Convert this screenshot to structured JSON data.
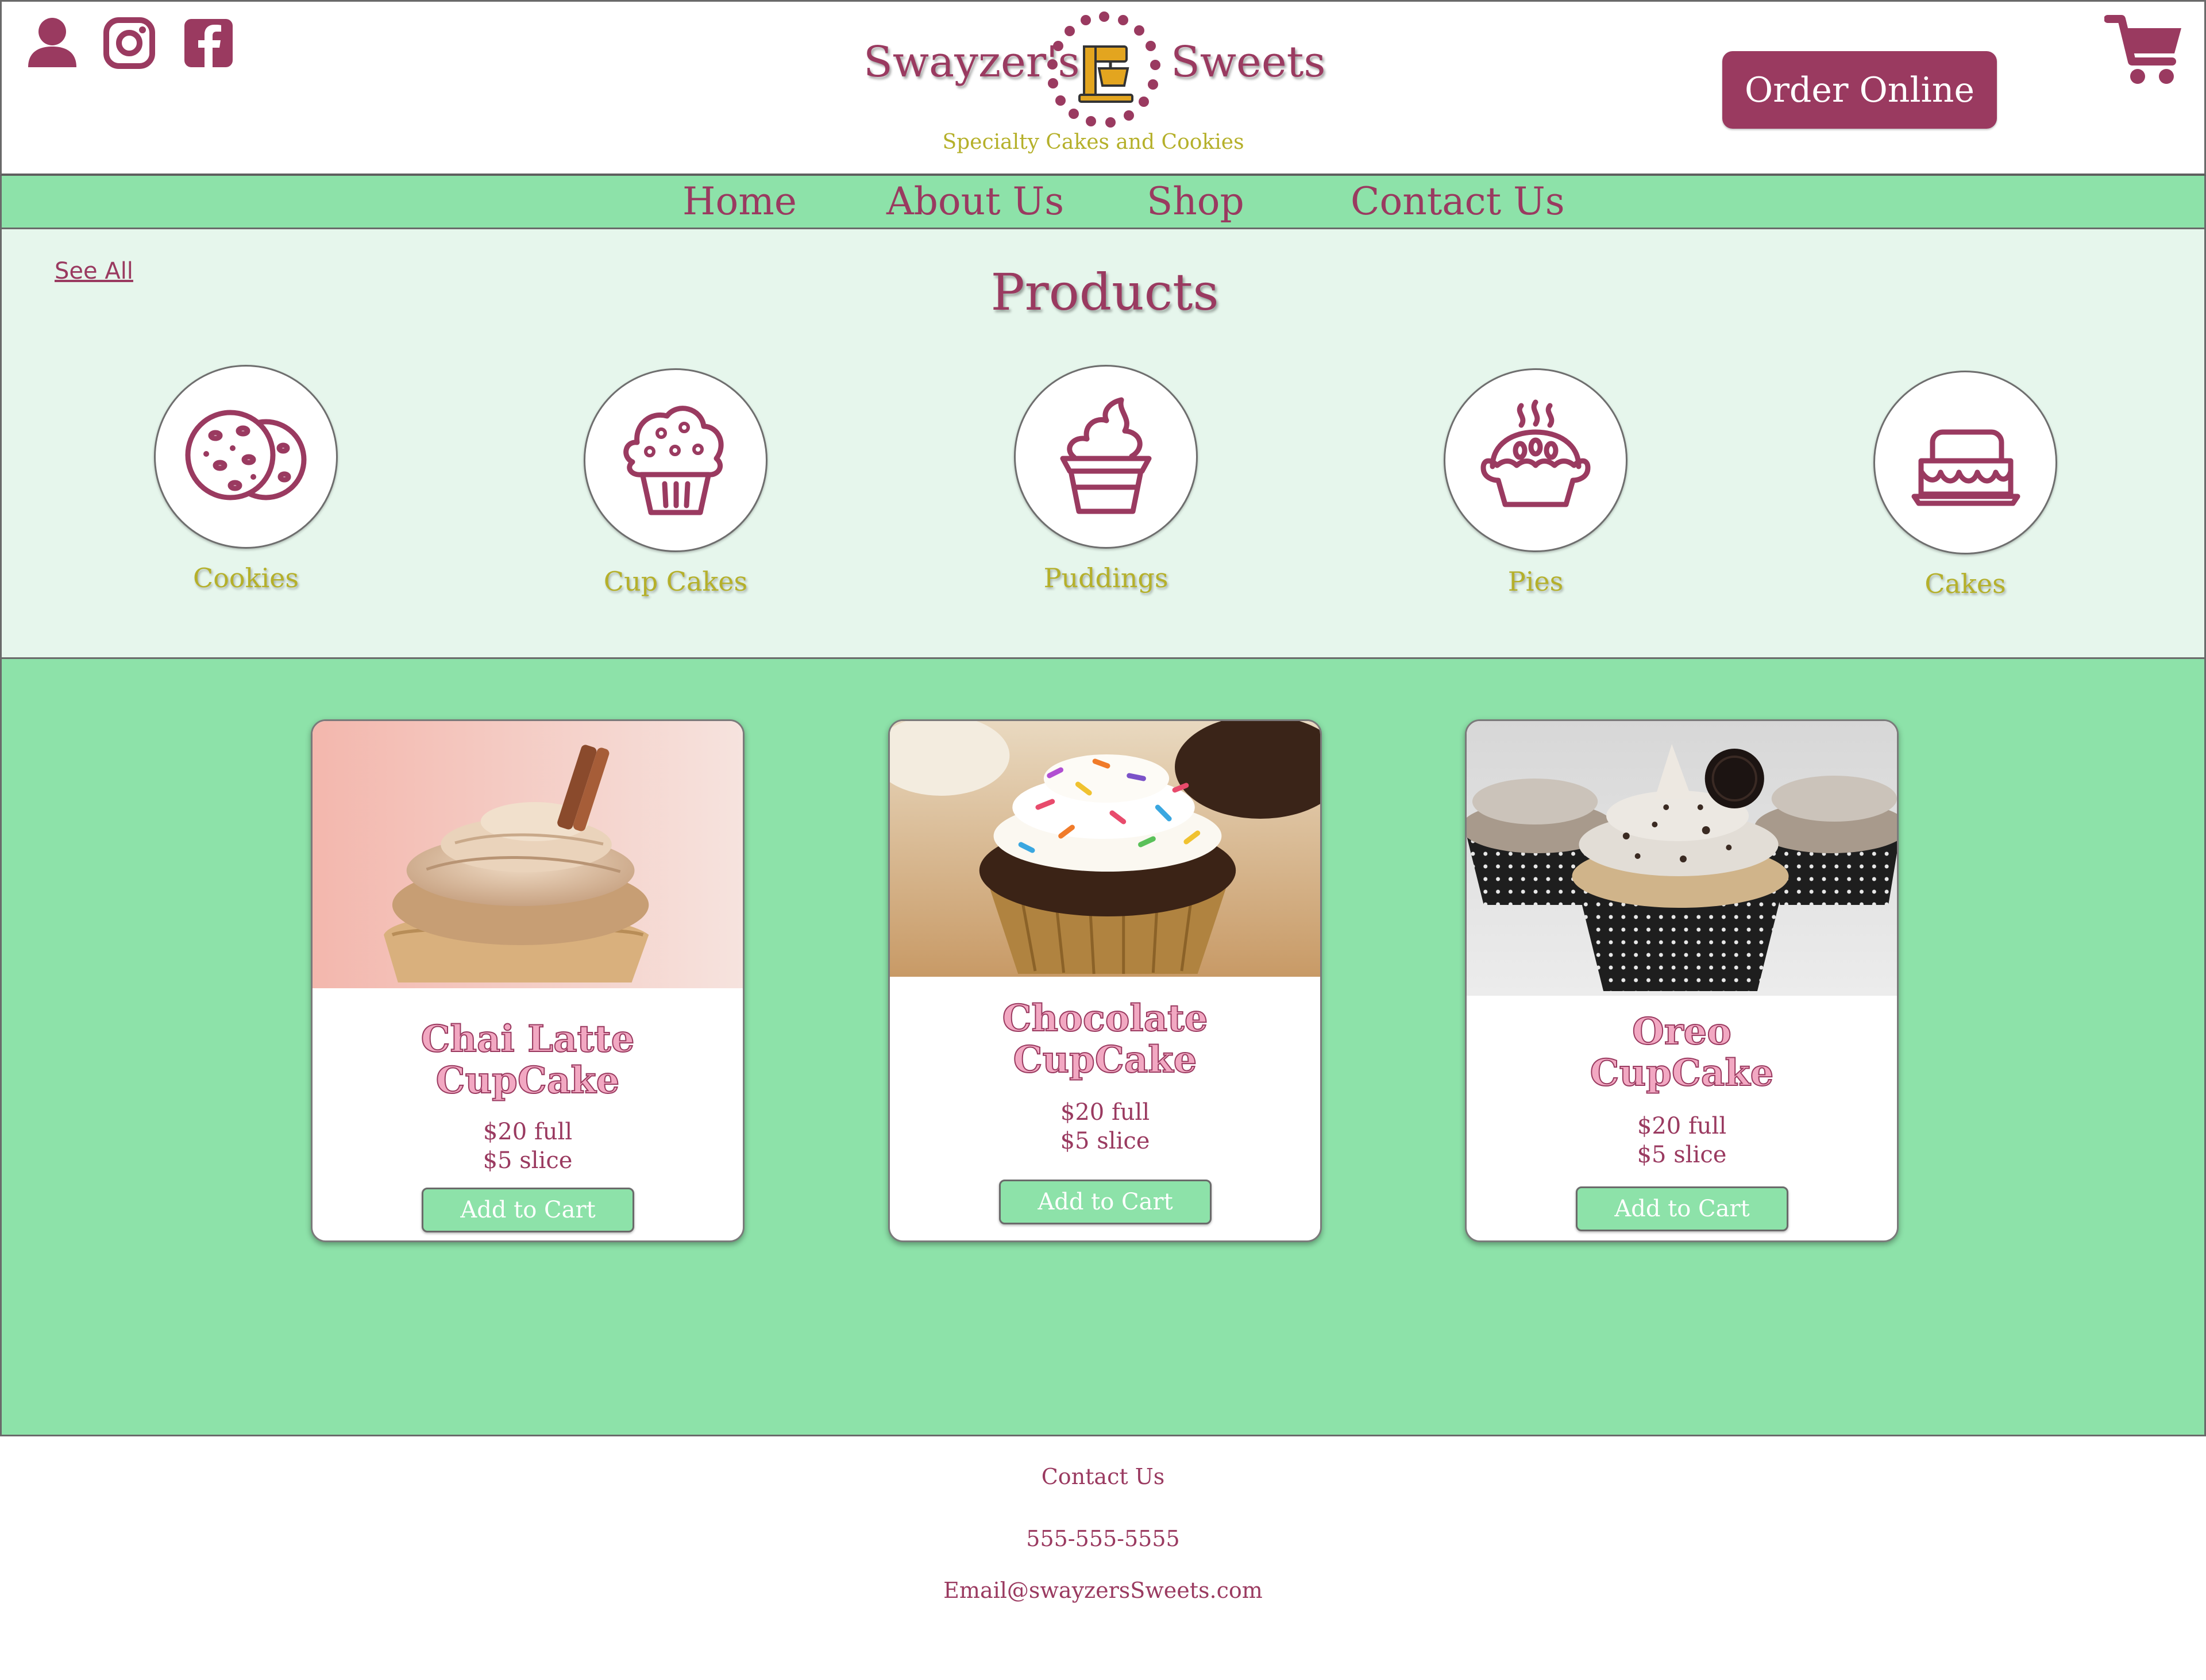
{
  "header": {
    "logo_left": "Swayzer's",
    "logo_right": "Sweets",
    "tagline": "Specialty Cakes and Cookies",
    "order_button": "Order Online",
    "icons": [
      "user-icon",
      "instagram-icon",
      "facebook-icon",
      "cart-icon"
    ]
  },
  "nav": {
    "items": [
      "Home",
      "About Us",
      "Shop",
      "Contact Us"
    ]
  },
  "categories": {
    "see_all": "See All",
    "title": "Products",
    "items": [
      {
        "label": "Cookies",
        "icon": "cookies-icon"
      },
      {
        "label": "Cup Cakes",
        "icon": "cupcake-icon"
      },
      {
        "label": "Puddings",
        "icon": "pudding-icon"
      },
      {
        "label": "Pies",
        "icon": "pie-icon"
      },
      {
        "label": "Cakes",
        "icon": "cake-icon"
      }
    ]
  },
  "products": [
    {
      "title_line1": "Chai Latte",
      "title_line2": "CupCake",
      "price_full": "$20 full",
      "price_slice": "$5 slice",
      "button": "Add to Cart"
    },
    {
      "title_line1": "Chocolate",
      "title_line2": "CupCake",
      "price_full": "$20 full",
      "price_slice": "$5 slice",
      "button": "Add to Cart"
    },
    {
      "title_line1": "Oreo",
      "title_line2": "CupCake",
      "price_full": "$20 full",
      "price_slice": "$5 slice",
      "button": "Add to Cart"
    }
  ],
  "footer": {
    "contact": "Contact Us",
    "phone": "555-555-5555",
    "email": "Email@swayzersSweets.com"
  },
  "colors": {
    "brand": "#9a3a60",
    "accent_green": "#8de2a9",
    "light_green": "#e6f6ec",
    "gold": "#b5b02a",
    "title_pink": "#f2a8c2"
  }
}
